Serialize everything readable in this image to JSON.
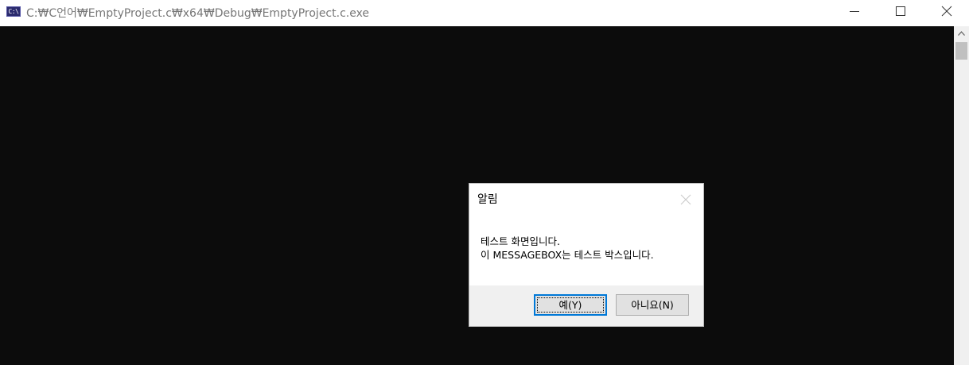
{
  "window": {
    "title": "C:₩C언어₩EmptyProject.c₩x64₩Debug₩EmptyProject.c.exe",
    "icon_label": "C:\\",
    "controls": {
      "minimize": "minimize-icon",
      "maximize": "maximize-icon",
      "close": "close-icon"
    }
  },
  "console": {
    "background": "#0c0c0c"
  },
  "messagebox": {
    "title": "알림",
    "message_line1": "테스트 화면입니다.",
    "message_line2": "이 MESSAGEBOX는 테스트 박스입니다.",
    "yes_label": "예(Y)",
    "no_label": "아니요(N)",
    "accent": "#0078d7"
  }
}
